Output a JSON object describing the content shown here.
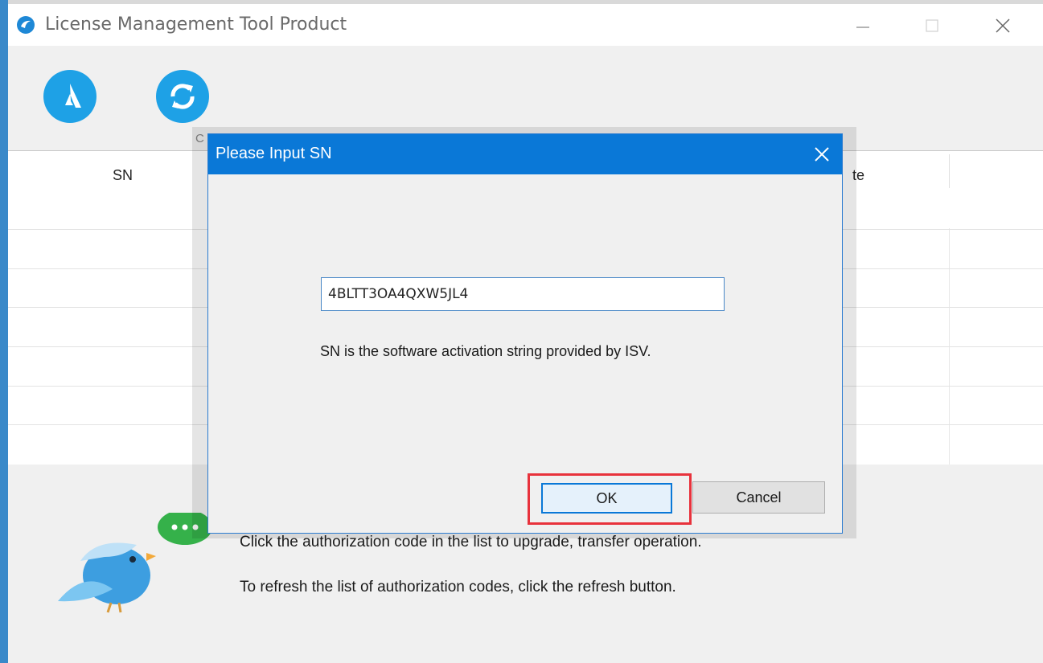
{
  "window": {
    "title": "License Management Tool Product"
  },
  "toolbar": {
    "activate_icon": "activate-icon",
    "refresh_icon": "refresh-icon"
  },
  "table": {
    "columns": [
      "SN",
      "te"
    ]
  },
  "hints": {
    "line1": "Click the authorization code in the list to upgrade, transfer operation.",
    "line2": "To refresh the list of authorization codes, click the refresh button."
  },
  "dialog": {
    "title": "Please Input SN",
    "behind_label": "C",
    "sn_value": "4BLTT3OA4QXW5JL4",
    "help_text": "SN is the software activation string provided by ISV.",
    "ok_label": "OK",
    "cancel_label": "Cancel"
  },
  "colors": {
    "accent": "#0a78d7",
    "tool_icon": "#1ea1e6",
    "highlight": "#e8323c"
  }
}
